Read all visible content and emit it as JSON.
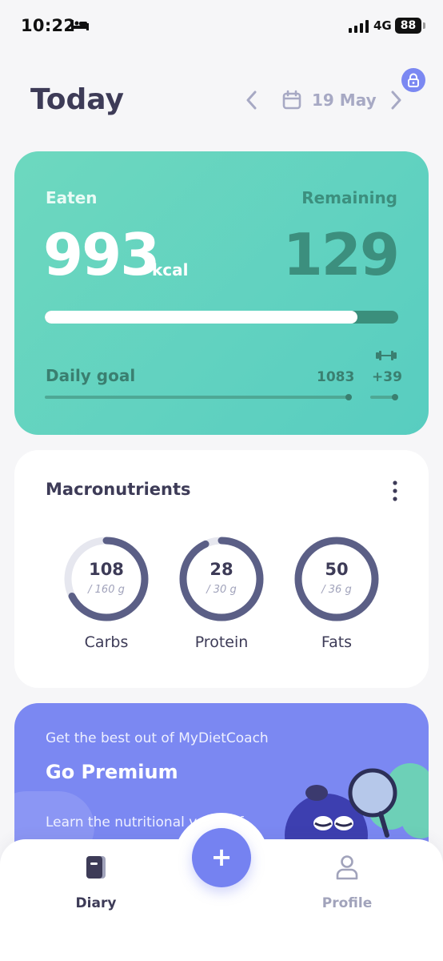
{
  "status_bar": {
    "time": "10:22",
    "network": "4G",
    "battery": "88"
  },
  "header": {
    "title": "Today",
    "date": "19 May"
  },
  "calories": {
    "eaten_label": "Eaten",
    "eaten_value": "993",
    "unit": "kcal",
    "remaining_label": "Remaining",
    "remaining_value": "129",
    "progress_fraction": 0.885,
    "daily_goal_label": "Daily goal",
    "daily_goal_value": "1083",
    "exercise_bonus": "+39"
  },
  "macros": {
    "title": "Macronutrients",
    "items": [
      {
        "name": "Carbs",
        "value": "108",
        "goal": "/ 160 g",
        "fraction": 0.675
      },
      {
        "name": "Protein",
        "value": "28",
        "goal": "/ 30 g",
        "fraction": 0.93
      },
      {
        "name": "Fats",
        "value": "50",
        "goal": "/ 36 g",
        "fraction": 1.0
      }
    ]
  },
  "premium": {
    "subtitle": "Get the best out of MyDietCoach",
    "headline": "Go Premium",
    "body": "Learn the nutritional value of"
  },
  "bottom_nav": {
    "add_label": "+",
    "diary_label": "Diary",
    "profile_label": "Profile"
  },
  "colors": {
    "accent": "#7b88f2",
    "calorie_card": "#5fd1c0",
    "ring_filled": "#5b5f86",
    "ring_track": "#e6e7ef"
  }
}
